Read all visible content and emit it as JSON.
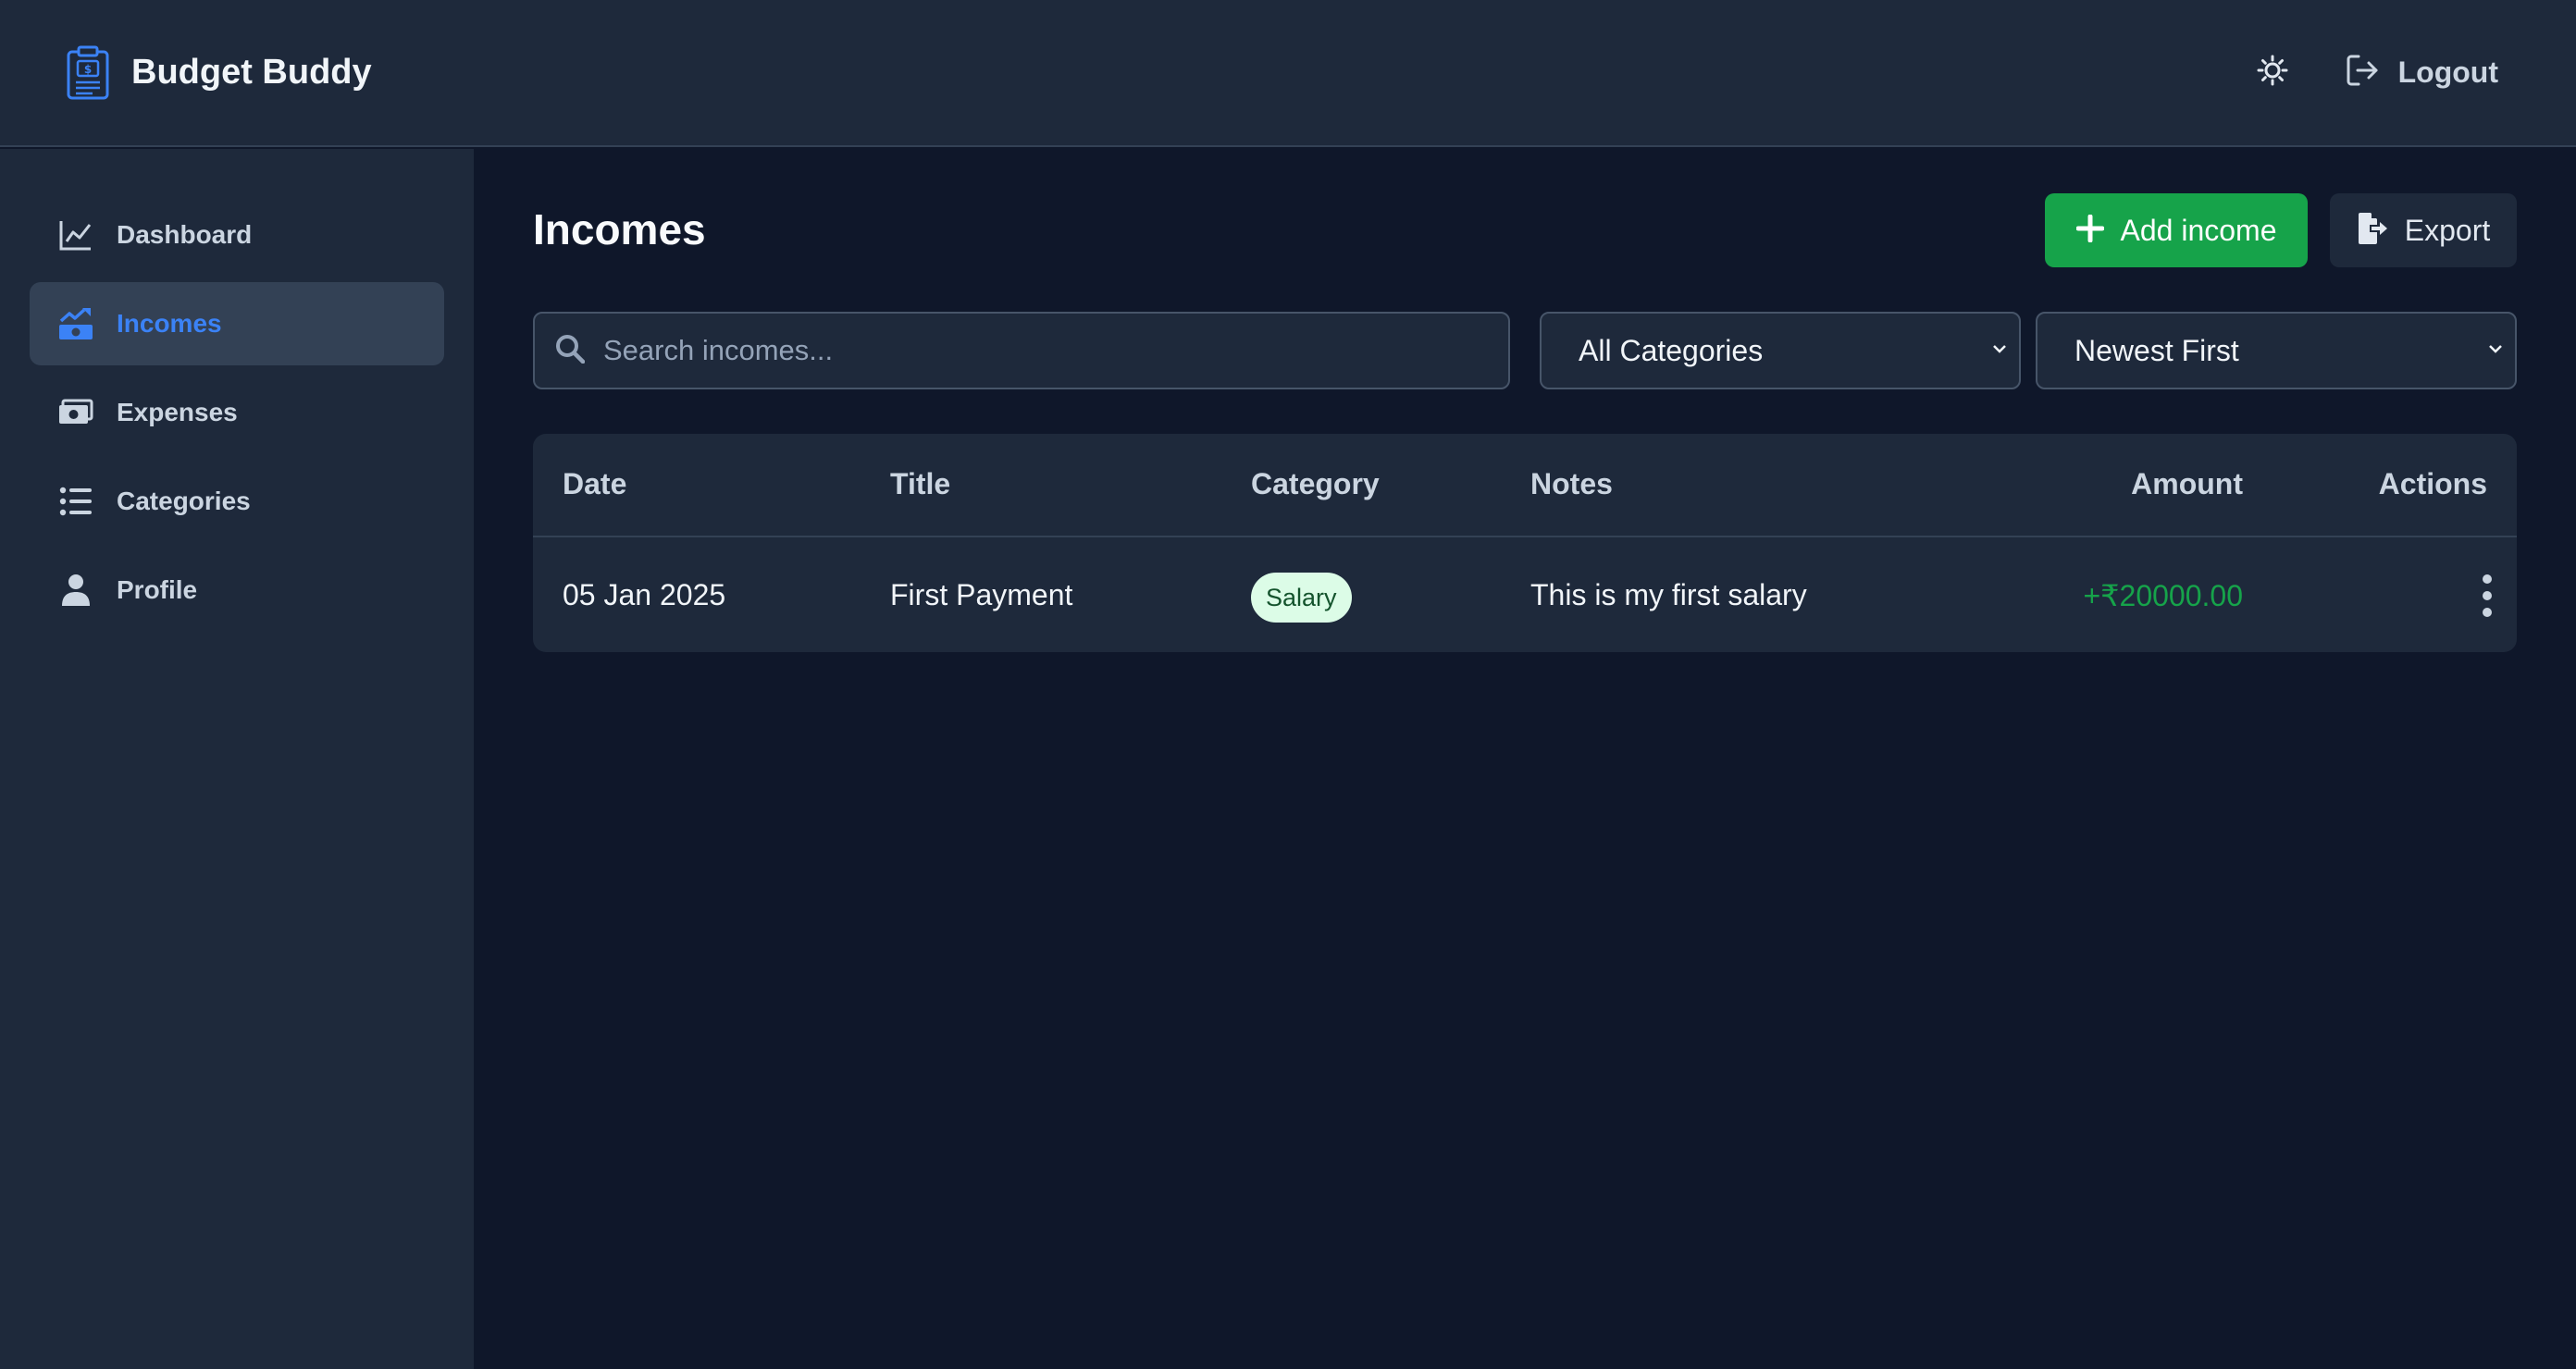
{
  "app": {
    "title": "Budget Buddy"
  },
  "header": {
    "logout_label": "Logout",
    "theme_icon": "sun-icon",
    "logout_icon": "logout-icon"
  },
  "sidebar": {
    "items": [
      {
        "label": "Dashboard",
        "icon": "chart-line-icon",
        "active": false
      },
      {
        "label": "Incomes",
        "icon": "money-bill-trend-up-icon",
        "active": true
      },
      {
        "label": "Expenses",
        "icon": "money-bill-wave-icon",
        "active": false
      },
      {
        "label": "Categories",
        "icon": "list-icon",
        "active": false
      },
      {
        "label": "Profile",
        "icon": "user-icon",
        "active": false
      }
    ]
  },
  "main": {
    "page_title": "Incomes",
    "add_button_label": "Add income",
    "export_button_label": "Export",
    "search": {
      "placeholder": "Search incomes...",
      "value": ""
    },
    "category_filter": {
      "selected": "All Categories"
    },
    "sort_filter": {
      "selected": "Newest First"
    },
    "table": {
      "columns": [
        "Date",
        "Title",
        "Category",
        "Notes",
        "Amount",
        "Actions"
      ],
      "rows": [
        {
          "date": "05 Jan 2025",
          "title": "First Payment",
          "category": "Salary",
          "notes": "This is my first salary",
          "amount": "+₹20000.00"
        }
      ]
    }
  },
  "colors": {
    "accent_green": "#16a34a",
    "active_blue": "#3b82f6",
    "background": "#0f172a",
    "panel": "#1e293b"
  }
}
